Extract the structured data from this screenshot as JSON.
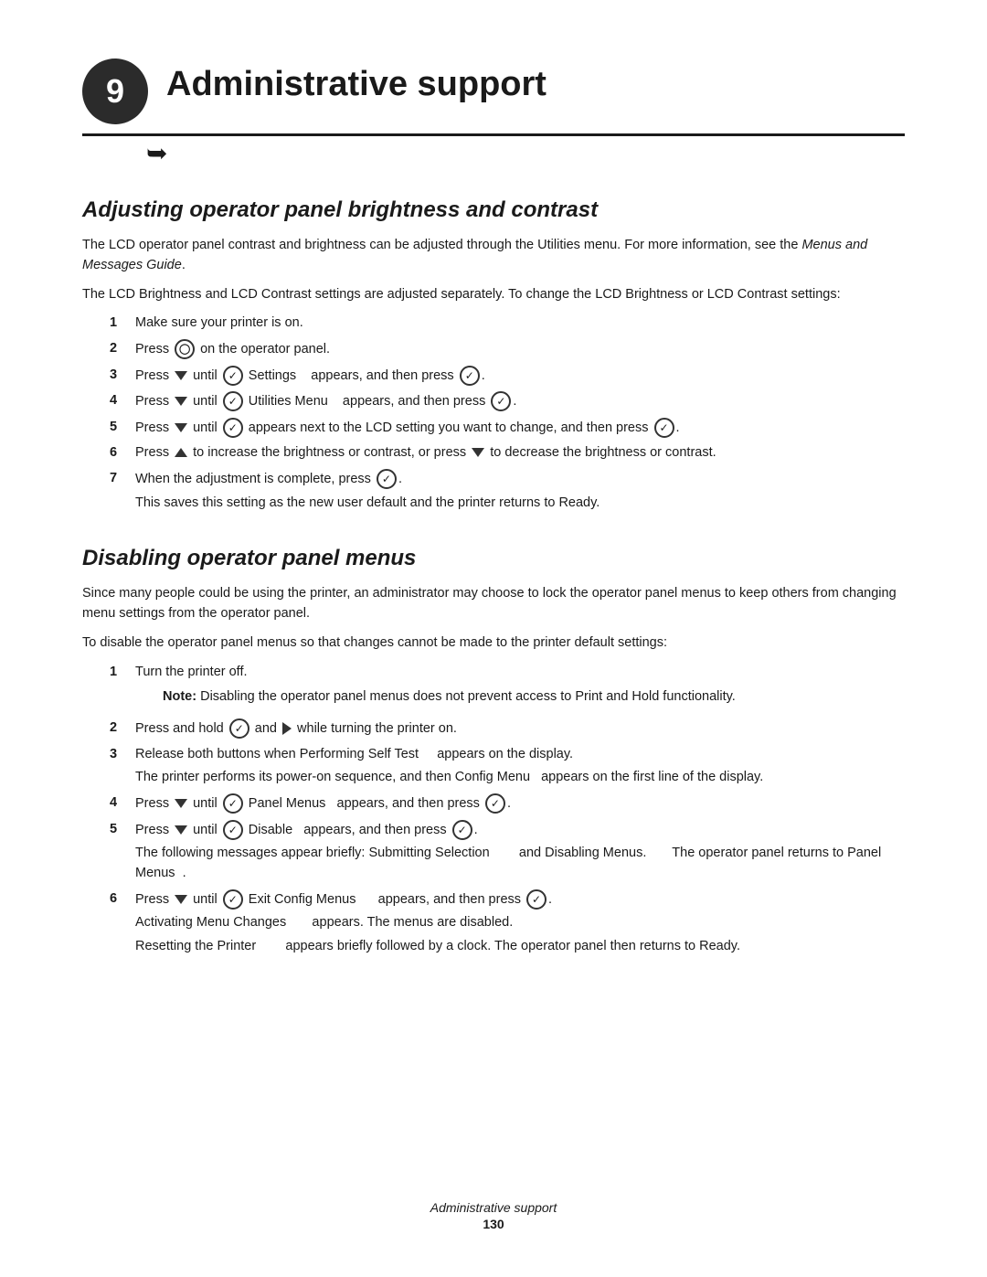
{
  "chapter": {
    "number": "9",
    "title": "Administrative support"
  },
  "section1": {
    "heading": "Adjusting operator panel brightness and contrast",
    "intro1": "The LCD operator panel contrast and brightness can be adjusted through the Utilities menu. For more information, see the Menus and Messages Guide.",
    "intro2": "The LCD Brightness and LCD Contrast settings are adjusted separately. To change the LCD Brightness or LCD Contrast settings:",
    "steps": [
      {
        "num": "1",
        "text": "Make sure your printer is on."
      },
      {
        "num": "2",
        "text": "Press [key-icon] on the operator panel."
      },
      {
        "num": "3",
        "text": "Press [down] until [check] Settings    appears, and then press [check-circle]."
      },
      {
        "num": "4",
        "text": "Press [down] until [check] Utilities Menu    appears, and then press [check-circle]."
      },
      {
        "num": "5",
        "text": "Press [down] until [check] appears next to the LCD setting you want to change, and then press [check-circle]."
      },
      {
        "num": "6",
        "text": "Press [up] to increase the brightness or contrast, or press [down] to decrease the brightness or contrast."
      },
      {
        "num": "7",
        "text": "When the adjustment is complete, press [check-circle].",
        "subtext": "This saves this setting as the new user default and the printer returns to Ready."
      }
    ]
  },
  "section2": {
    "heading": "Disabling operator panel menus",
    "intro1": "Since many people could be using the printer, an administrator may choose to lock the operator panel menus to keep others from changing menu settings from the operator panel.",
    "intro2": "To disable the operator panel menus so that changes cannot be made to the printer default settings:",
    "steps": [
      {
        "num": "1",
        "text": "Turn the printer off.",
        "note": "Note:  Disabling the operator panel menus does not prevent access to Print and Hold functionality."
      },
      {
        "num": "2",
        "text": "Press and hold [check-circle] and [right] while turning the printer on."
      },
      {
        "num": "3",
        "text": "Release both buttons when Performing Self Test     appears on the display.",
        "subtext": "The printer performs its power-on sequence, and then Config Menu   appears on the first line of the display."
      },
      {
        "num": "4",
        "text": "Press [down] until [check] Panel Menus   appears, and then press [check-circle]."
      },
      {
        "num": "5",
        "text": "Press [down] until [check] Disable   appears, and then press [check-circle].",
        "subtext": "The following messages appear briefly: Submitting Selection        and Disabling Menus.       The operator panel returns to Panel Menus  ."
      },
      {
        "num": "6",
        "text": "Press [down] until [check] Exit Config Menus      appears, and then press [check-circle].",
        "subtext1": "Activating Menu Changes      appears. The menus are disabled.",
        "subtext2": "Resetting the Printer       appears briefly followed by a clock. The operator panel then returns to Ready."
      }
    ]
  },
  "footer": {
    "italic_text": "Administrative support",
    "page_number": "130"
  }
}
